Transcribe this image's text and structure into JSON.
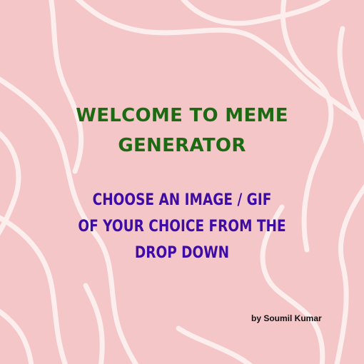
{
  "colors": {
    "background": "#f4c6c7",
    "swirl": "#fdeeee",
    "heading": "#1c6b12",
    "subheading": "#3d0ca6",
    "author": "#111111"
  },
  "heading": {
    "line1": "WELCOME TO MEME",
    "line2": "GENERATOR"
  },
  "instructions": {
    "line1": "CHOOSE AN IMAGE / GIF",
    "line2": "OF YOUR CHOICE FROM THE",
    "line3": "DROP DOWN"
  },
  "author": "by Soumil Kumar"
}
